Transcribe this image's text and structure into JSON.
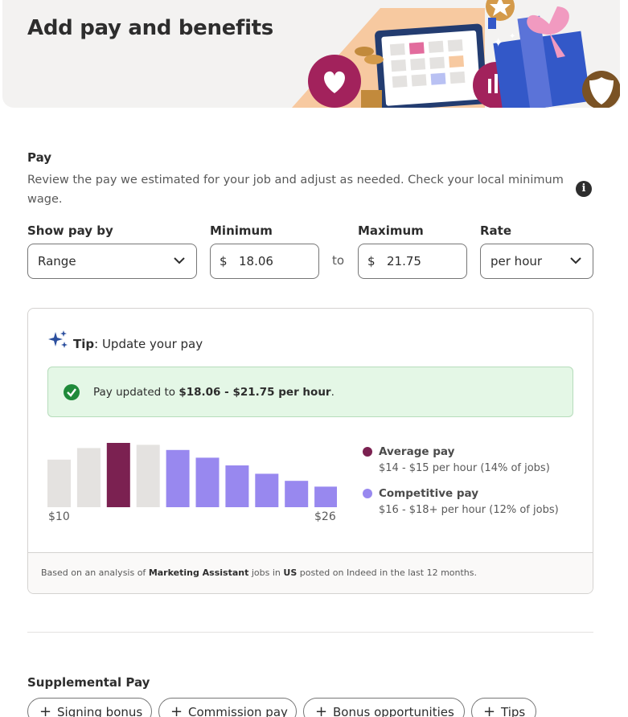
{
  "header": {
    "title": "Add pay and benefits"
  },
  "pay": {
    "section_title": "Pay",
    "description": "Review the pay we estimated for your job and adjust as needed. Check your local minimum wage.",
    "info_icon": "i",
    "show_pay_by": {
      "label": "Show pay by",
      "value": "Range"
    },
    "minimum": {
      "label": "Minimum",
      "currency": "$",
      "value": "18.06"
    },
    "to_text": "to",
    "maximum": {
      "label": "Maximum",
      "currency": "$",
      "value": "21.75"
    },
    "rate": {
      "label": "Rate",
      "value": "per hour"
    }
  },
  "tip": {
    "title_bold": "Tip",
    "title_rest": ": Update your pay",
    "success_prefix": "Pay updated to ",
    "success_bold": "$18.06 - $21.75 per hour",
    "success_suffix": ".",
    "legend": [
      {
        "title": "Average pay",
        "subtitle": "$14 - $15 per hour (14% of jobs)",
        "color": "#7b2151"
      },
      {
        "title": "Competitive pay",
        "subtitle": "$16 - $18+ per hour (12% of jobs)",
        "color": "#9888ef"
      }
    ],
    "footnote": {
      "prefix": "Based on an analysis of ",
      "job": "Marketing Assistant",
      "middle": " jobs in ",
      "country": "US",
      "suffix": " posted on Indeed in the last 12 months."
    }
  },
  "chart_data": {
    "type": "bar",
    "x_min_label": "$10",
    "x_max_label": "$26",
    "values": [
      0.74,
      0.92,
      1.0,
      0.97,
      0.89,
      0.77,
      0.65,
      0.52,
      0.41,
      0.32
    ],
    "groups": [
      "other",
      "other",
      "average",
      "other",
      "competitive",
      "competitive",
      "competitive",
      "competitive",
      "competitive",
      "competitive"
    ],
    "colors": {
      "other": "#e4e2e0",
      "average": "#7b2151",
      "competitive": "#9888ef"
    }
  },
  "supplemental": {
    "section_title": "Supplemental Pay",
    "chips": [
      {
        "label": "Signing bonus"
      },
      {
        "label": "Commission pay"
      },
      {
        "label": "Bonus opportunities"
      },
      {
        "label": "Tips"
      }
    ]
  }
}
